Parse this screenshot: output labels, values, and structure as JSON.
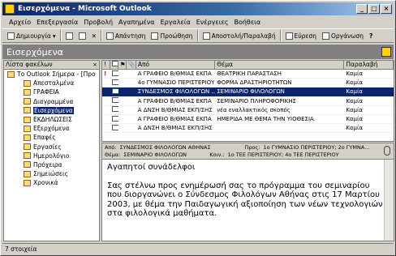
{
  "window": {
    "title": "Εισερχόμενα - Microsoft Outlook"
  },
  "menu": [
    "Αρχείο",
    "Επεξεργασία",
    "Προβολή",
    "Αγαπημένα",
    "Εργαλεία",
    "Ενέργειες",
    "Βοήθεια"
  ],
  "toolbar": {
    "new": "Δημιουργία",
    "reply": "Απάντηση",
    "forward": "Προώθηση",
    "sendrecv": "Αποστολή/Παραλαβή",
    "find": "Εύρεση",
    "organize": "Οργάνωση"
  },
  "banner": {
    "title": "Εισερχόμενα"
  },
  "folders": {
    "header": "Λίστα φακέλων",
    "items": [
      {
        "label": "Το Outlook Σήμερα - [Προ",
        "indent": 0
      },
      {
        "label": "Απεσταλμένα",
        "indent": 1
      },
      {
        "label": "ΓΡΑΦΕΙΑ",
        "indent": 1
      },
      {
        "label": "Διαγραμμένα",
        "indent": 1
      },
      {
        "label": "Εισερχόμενα",
        "indent": 1,
        "selected": true
      },
      {
        "label": "ΕΚΔΗΛΩΣΕΙΣ",
        "indent": 1
      },
      {
        "label": "Εξερχόμενα",
        "indent": 1
      },
      {
        "label": "Επαφές",
        "indent": 1
      },
      {
        "label": "Εργασίες",
        "indent": 1
      },
      {
        "label": "Ημερολόγιο",
        "indent": 1
      },
      {
        "label": "Πρόχειρα",
        "indent": 1
      },
      {
        "label": "Σημειώσεις",
        "indent": 1
      },
      {
        "label": "Χρονικά",
        "indent": 1
      }
    ]
  },
  "messages": {
    "headers": [
      "!",
      "",
      "",
      "",
      "Από",
      "Θέμα",
      "Παραλαβή"
    ],
    "rows": [
      {
        "imp": "!",
        "from": "Α ΓΡΑΦΕΙΟ Β/ΘΜΙΑΣ ΕΚΠΑ",
        "subject": "ΘΕΑΤΡΙΚΗ ΠΑΡΑΣΤΑΣΗ",
        "recv": "Καμία"
      },
      {
        "imp": "",
        "from": "4ο ΓΥΜΝΑΣΙΟ ΠΕΡΙΣΤΕΡΙΟΥ",
        "subject": "ΦΟΡΜΑ ΔΡΑΣΤΗΡΙΟΤΗΤΩΝ",
        "recv": "Καμία"
      },
      {
        "imp": "",
        "from": "ΣΥΝΔΕΣΜΟΣ ΦΙΛΟΛΟΓΩΝ ...",
        "subject": "ΣΕΜΙΝΑΡΙΟ ΦΙΛΟΛΟΓΩΝ",
        "recv": "Καμία",
        "selected": true
      },
      {
        "imp": "",
        "from": "Α ΓΡΑΦΕΙΟ Β/ΘΜΙΑΣ ΕΚΠΑ",
        "subject": "ΣΕΜΙΝΑΡΙΟ ΠΛΗΡΟΦΟΡΙΚΗΣ",
        "recv": "Καμία"
      },
      {
        "imp": "",
        "from": "Α ΔΝΣΗ Β/ΘΜΙΑΣ ΕΚΠ/ΣΗΣ",
        "subject": "νέα εναλλακτικός σκοπός",
        "recv": "Καμία"
      },
      {
        "imp": "",
        "from": "Α ΓΡΑΦΕΙΟ Β/ΘΜΙΑΣ ΕΚΠΑ",
        "subject": "ΗΜΕΡΙΔΑ ΜΕ ΘΕΜΑ ΤΗΝ ΥΙΟΘΕΣΙΑ",
        "recv": "Καμία"
      },
      {
        "imp": "",
        "from": "Α ΔΝΣΗ Β/ΘΜΙΑΣ ΕΚΠ/ΣΗΣ",
        "subject": "",
        "recv": "Καμία"
      }
    ]
  },
  "preview": {
    "from_label": "Από:",
    "from": "ΣΥΝΔΕΣΜΟΣ ΦΙΛΟΛΟΓΩΝ ΑΘΗΝΑΣ",
    "to_label": "Προς:",
    "to": "1ο ΓΥΜΝΑΣΙΟ ΠΕΡΙΣΤΕΡΙΟΥ; 2ο ΓΥΜΝΑ...",
    "subject_label": "Θέμα:",
    "subject": "ΣΕΜΙΝΑΡΙΟ ΦΙΛΟΛΟΓΩΝ",
    "cc_label": "Κοιν.:",
    "cc": "1ο ΤΕΕ ΠΕΡΙΣΤΕΡΙΟΥ; 4ο ΤΕΕ ΠΕΡΙΣΤΕΡΙΟΥ",
    "greeting": "Αγαπητοί συνάδελφοι",
    "body": "Σας στέλνω προς ενημέρωσή σας το πρόγραμμα του σεμιναρίου που διοργανώνει ο Σύνδεσμος Φιλολόγων Αθήνας στις 17 Μαρτίου 2003, με θέμα την Παιδαγωγική αξιοποίηση των νέων τεχνολογιών στα φιλολογικά μαθήματα."
  },
  "status": {
    "text": "7 στοιχεία"
  }
}
